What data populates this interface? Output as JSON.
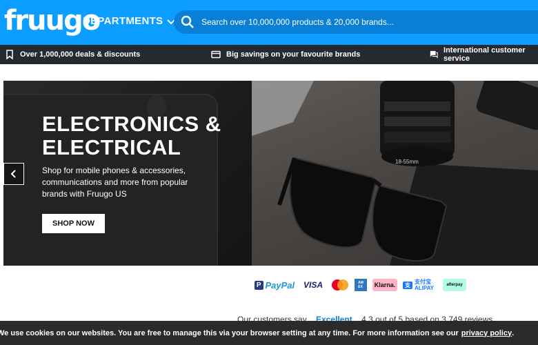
{
  "header": {
    "logo": "fruugo",
    "departments_label": "DEPARTMENTS",
    "search_placeholder": "Search over 10,000,000 products & 20,000 brands..."
  },
  "infobar": {
    "items": [
      {
        "icon": "bookmark-icon",
        "label": "Over 1,000,000 deals & discounts"
      },
      {
        "icon": "card-icon",
        "label": "Big savings on your favourite brands"
      },
      {
        "icon": "chat-icon",
        "label": "International customer service"
      }
    ]
  },
  "hero": {
    "title_line1": "ELECTRONICS &",
    "title_line2": "ELECTRICAL",
    "description": "Shop for mobile phones & accessories, communications and more from popular brands with Fruugo US",
    "button": "SHOP NOW",
    "camera_lens_text": "18-55mm"
  },
  "payments": [
    "PayPal",
    "VISA",
    "Mastercard",
    "American Express",
    "Klarna.",
    "支付宝 ALIPAY",
    "afterpay"
  ],
  "reviews": {
    "prefix": "Our customers say",
    "rating_word": "Excellent",
    "score": "4.3",
    "suffix_a": "out of 5 based on",
    "count": "3,749",
    "suffix_b": "reviews"
  },
  "cookie": {
    "text": "We use cookies on our websites. You are free to manage this via your browser setting at any time. For more information see our",
    "link": "privacy policy",
    "end": "."
  }
}
